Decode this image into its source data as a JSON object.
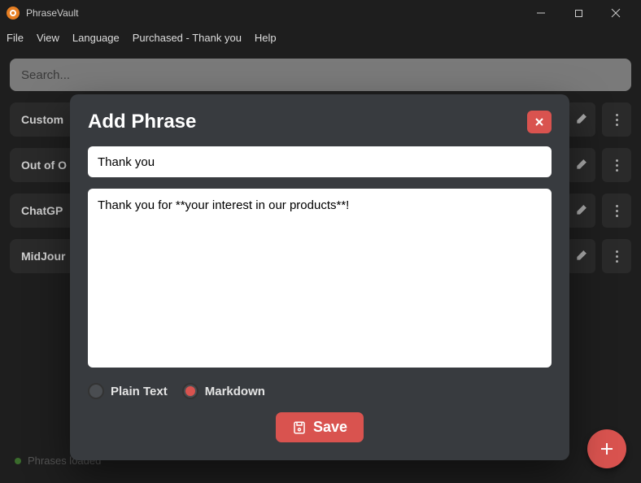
{
  "app": {
    "title": "PhraseVault"
  },
  "menu": {
    "file": "File",
    "view": "View",
    "language": "Language",
    "purchased": "Purchased - Thank you",
    "help": "Help"
  },
  "search": {
    "placeholder": "Search..."
  },
  "phrases": [
    {
      "label": "Custom"
    },
    {
      "label": "Out of O"
    },
    {
      "label": "ChatGP"
    },
    {
      "label": "MidJour"
    }
  ],
  "status": {
    "text": "Phrases loaded"
  },
  "modal": {
    "title": "Add Phrase",
    "title_value": "Thank you",
    "body_value": "Thank you for **your interest in our products**!",
    "format_plain": "Plain Text",
    "format_markdown": "Markdown",
    "format_selected": "markdown",
    "save_label": "Save"
  },
  "colors": {
    "accent": "#d9534f"
  }
}
